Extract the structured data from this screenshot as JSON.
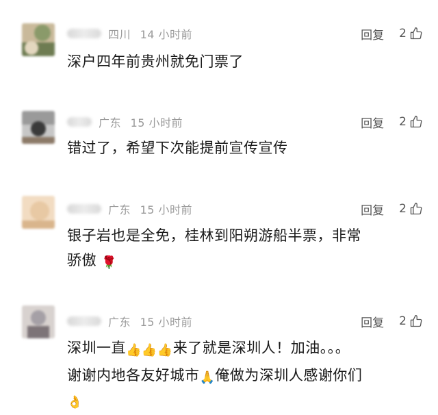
{
  "actions": {
    "reply_label": "回复"
  },
  "comments": [
    {
      "location": "四川",
      "time": "14 小时前",
      "likes": "2",
      "lines": [
        "深户四年前贵州就免门票了"
      ],
      "avatar_colors": [
        "#8a9a6a",
        "#c9b99a",
        "#6e7c52"
      ]
    },
    {
      "location": "广东",
      "time": "15 小时前",
      "likes": "2",
      "lines": [
        "错过了，希望下次能提前宣传宣传"
      ],
      "avatar_colors": [
        "#3a3a3a",
        "#c7c7c7",
        "#8c7a68"
      ]
    },
    {
      "location": "广东",
      "time": "15 小时前",
      "likes": "2",
      "lines": [
        "银子岩也是全免，桂林到阳朔游船半票，非常",
        "骄傲"
      ],
      "line2_emoji": "🌹",
      "avatar_colors": [
        "#e8c9a4",
        "#f2dcc2",
        "#d9b58c"
      ]
    },
    {
      "location": "广东",
      "time": "15 小时前",
      "likes": "2",
      "lines": [
        "深圳一直",
        "来了就是深圳人！加油。。。",
        "谢谢内地各友好城市",
        "俺做为深圳人感谢你们"
      ],
      "emoji_thumbs": "👍",
      "emoji_pray": "🙏",
      "emoji_ok": "👌",
      "avatar_colors": [
        "#a5a0a6",
        "#d8d2cf",
        "#7d7478"
      ]
    }
  ]
}
